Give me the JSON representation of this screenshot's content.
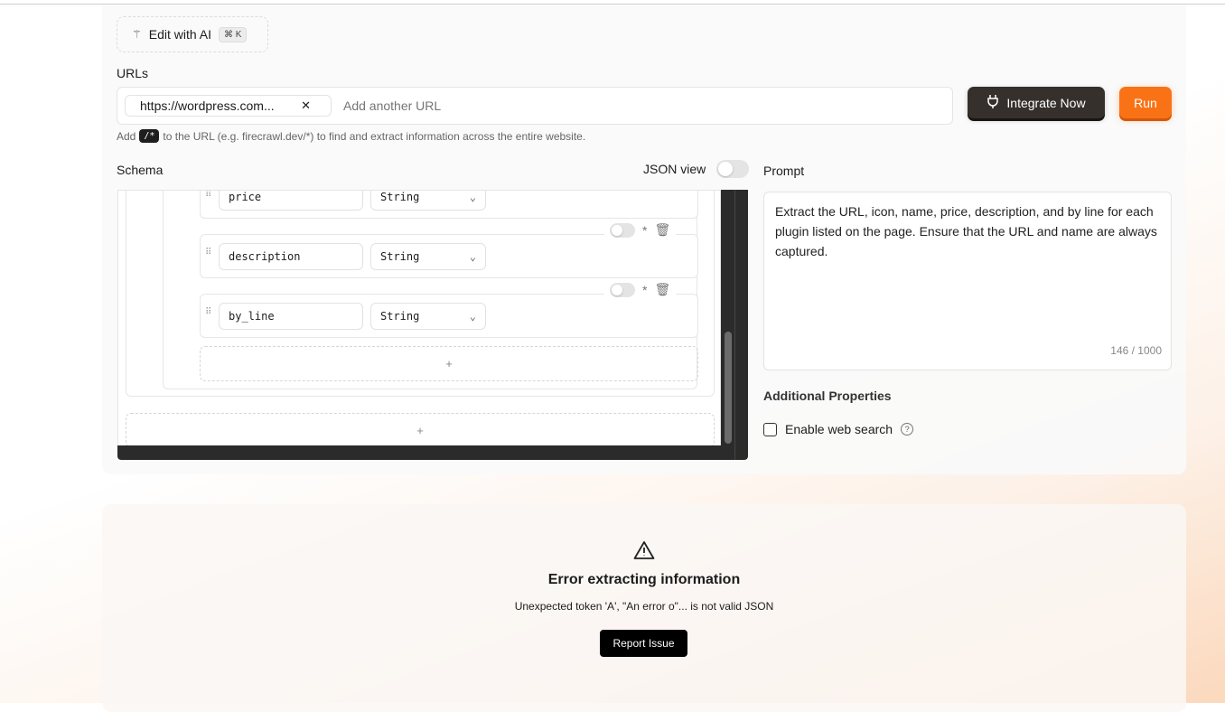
{
  "toolbar": {
    "edit_ai_label": "Edit with AI",
    "edit_ai_shortcut": "⌘ K"
  },
  "urls": {
    "label": "URLs",
    "chip": "https://wordpress.com...",
    "placeholder": "Add another URL",
    "hint_pre": "Add",
    "hint_code": "/*",
    "hint_post": "to the URL (e.g. firecrawl.dev/*) to find and extract information across the entire website."
  },
  "actions": {
    "integrate": "Integrate Now",
    "run": "Run"
  },
  "schema": {
    "label": "Schema",
    "json_view": "JSON view",
    "fields": [
      {
        "name": "price",
        "type": "String"
      },
      {
        "name": "description",
        "type": "String"
      },
      {
        "name": "by_line",
        "type": "String"
      }
    ],
    "required_mark": "*",
    "add": "+"
  },
  "prompt": {
    "label": "Prompt",
    "text": "Extract the URL, icon, name, price, description, and by line for each plugin listed on the page. Ensure that the URL and name are always captured.",
    "count": "146 / 1000"
  },
  "additional": {
    "label": "Additional Properties",
    "web_search": "Enable web search"
  },
  "error": {
    "title": "Error extracting information",
    "message": "Unexpected token 'A', \"An error o\"... is not valid JSON",
    "report": "Report Issue"
  }
}
